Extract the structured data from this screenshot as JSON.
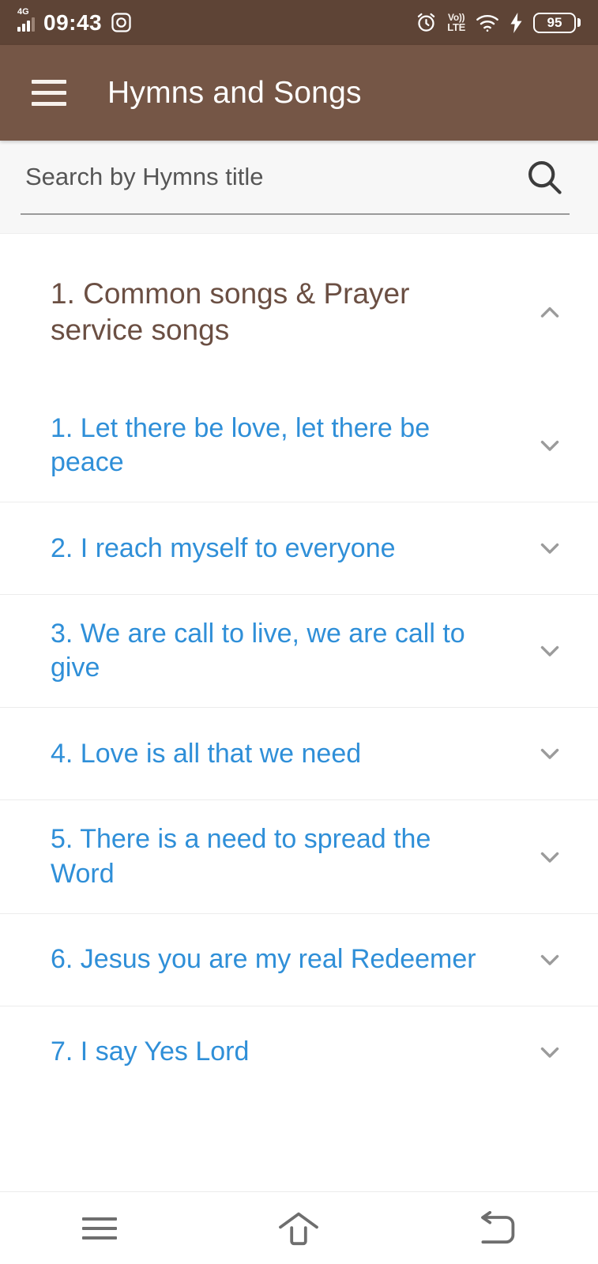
{
  "status_bar": {
    "network_type": "4G",
    "time": "09:43",
    "camera_icon": "camera-icon",
    "alarm_icon": "alarm-clock-icon",
    "volte_top": "Vo))",
    "volte_bottom": "LTE",
    "wifi_icon": "wifi-icon",
    "charging_icon": "charging-bolt-icon",
    "battery_level": "95"
  },
  "app_bar": {
    "menu_icon": "hamburger-menu-icon",
    "title": "Hymns and Songs"
  },
  "search": {
    "placeholder": "Search by Hymns title",
    "value": "",
    "icon": "search-icon"
  },
  "category": {
    "title": "1. Common songs & Prayer service songs",
    "expanded": true,
    "chevron": "chevron-up-icon"
  },
  "songs": [
    {
      "title": "1. Let there be love, let there be peace",
      "chevron": "chevron-down-icon"
    },
    {
      "title": "2. I reach myself to everyone",
      "chevron": "chevron-down-icon"
    },
    {
      "title": "3. We are call to live, we are call to give",
      "chevron": "chevron-down-icon"
    },
    {
      "title": "4. Love is all that we need",
      "chevron": "chevron-down-icon"
    },
    {
      "title": "5. There is a need to spread the Word",
      "chevron": "chevron-down-icon"
    },
    {
      "title": "6. Jesus you are my real Redeemer",
      "chevron": "chevron-down-icon"
    },
    {
      "title": "7. I say Yes Lord",
      "chevron": "chevron-down-icon"
    }
  ],
  "nav_bar": {
    "recents": "recents-icon",
    "home": "home-icon",
    "back": "back-icon"
  },
  "colors": {
    "status_bar_bg": "#5e4436",
    "app_bar_bg": "#755646",
    "search_bg": "#f7f7f7",
    "category_text": "#6b4f43",
    "song_link": "#2f8fd8",
    "chevron": "#9b9b9b",
    "divider": "#ececec"
  }
}
